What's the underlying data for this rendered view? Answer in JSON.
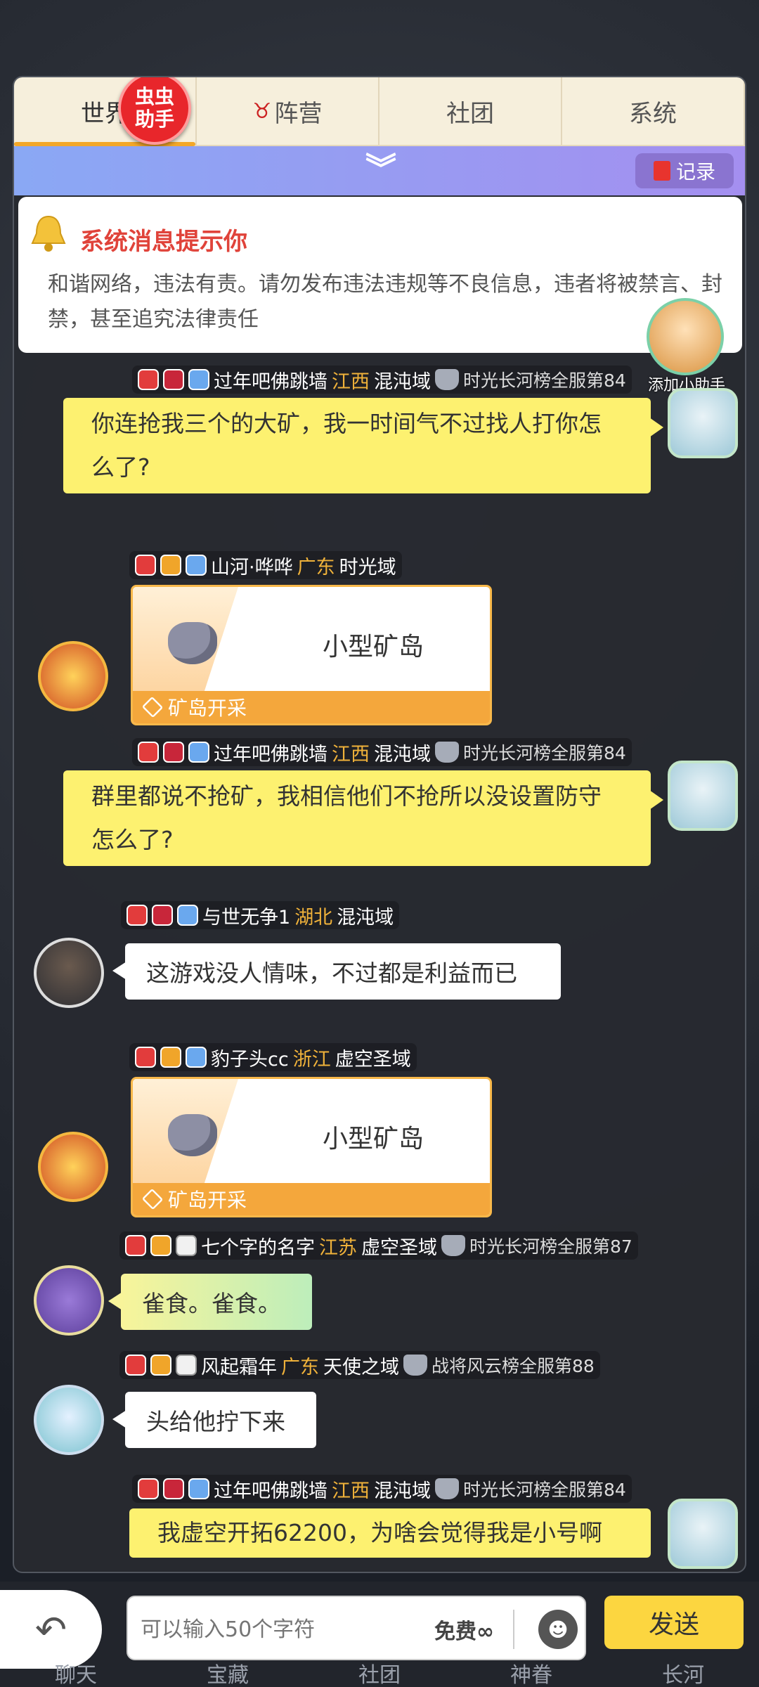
{
  "tabs": [
    {
      "label": "世界",
      "active": true
    },
    {
      "label": "阵营"
    },
    {
      "label": "社团"
    },
    {
      "label": "系统"
    }
  ],
  "helper_badge": "虫虫\n助手",
  "record_label": "记录",
  "notice": {
    "title": "系统消息提示你",
    "body": "和谐网络，违法有责。请勿发布违法违规等不良信息，违者将被禁言、封禁，甚至追究法律责任"
  },
  "helper_avatar_label": "添加小助手",
  "messages": [
    {
      "name": "过年吧佛跳墙",
      "province": "江西",
      "server": "混沌域",
      "rank": "时光长河榜全服第84",
      "text": "你连抢我三个的大矿，我一时间气不过找人打你怎么了?"
    },
    {
      "name": "山河·哗哗",
      "province": "广东",
      "server": "时光域",
      "card_title": "小型矿岛",
      "card_footer": "矿岛开采"
    },
    {
      "name": "过年吧佛跳墙",
      "province": "江西",
      "server": "混沌域",
      "rank": "时光长河榜全服第84",
      "text": "群里都说不抢矿，我相信他们不抢所以没设置防守怎么了?"
    },
    {
      "name": "与世无争1",
      "province": "湖北",
      "server": "混沌域",
      "text": "这游戏没人情味，不过都是利益而已"
    },
    {
      "name": "豹子头cc",
      "province": "浙江",
      "server": "虚空圣域",
      "card_title": "小型矿岛",
      "card_footer": "矿岛开采"
    },
    {
      "name": "七个字的名字",
      "province": "江苏",
      "server": "虚空圣域",
      "rank": "时光长河榜全服第87",
      "text": "雀食。雀食。"
    },
    {
      "name": "风起霜年",
      "province": "广东",
      "server": "天使之域",
      "rank": "战将风云榜全服第88",
      "text": "头给他拧下来"
    },
    {
      "name": "过年吧佛跳墙",
      "province": "江西",
      "server": "混沌域",
      "rank": "时光长河榜全服第84",
      "text": "我虚空开拓62200，为啥会觉得我是小号啊"
    }
  ],
  "input": {
    "placeholder": "可以输入50个字符",
    "free_label": "免费∞"
  },
  "send_label": "发送",
  "bottom_nav": [
    "聊天",
    "宝藏",
    "社团",
    "神眷",
    "长河"
  ],
  "colors": {
    "accent": "#f3a728",
    "send": "#fcd640",
    "bubble_self": "#fdf170",
    "province": "#f0b23a"
  }
}
